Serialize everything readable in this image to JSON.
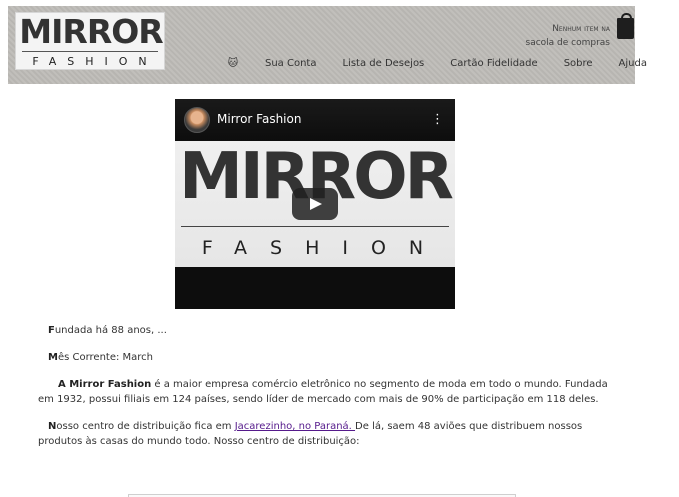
{
  "logo": {
    "top": "MIRROR",
    "bottom": "FASHION"
  },
  "cart": {
    "line1_caps": "Nenhum item na",
    "line2": "sacola de compras",
    "icon": "shopping-bag-icon"
  },
  "nav": {
    "icon": "cat-icon",
    "items": [
      "Sua Conta",
      "Lista de Desejos",
      "Cartão Fidelidade",
      "Sobre",
      "Ajuda"
    ]
  },
  "video": {
    "channel": "Mirror Fashion",
    "frame_top": "MIRROR",
    "frame_bottom": "FASHION",
    "play_icon": "play-icon",
    "menu_icon": "more-vertical-icon"
  },
  "content": {
    "p1": {
      "lead": "F",
      "rest": "undada há 88 anos, ..."
    },
    "p2": {
      "lead": "M",
      "rest": "ês Corrente: March"
    },
    "p3": {
      "brand": "A Mirror Fashion",
      "rest": " é a maior empresa comércio eletrônico no segmento de moda em todo o mundo. Fundada em 1932, possui filiais em 124 países, sendo líder de mercado com mais de 90% de participação em 118 deles."
    },
    "p4": {
      "lead": "N",
      "before": "osso centro de distribuição fica em ",
      "link": "Jacarezinho, no Paraná. ",
      "after": "De lá, saem 48 aviões que distribuem nossos produtos às casas do mundo todo. Nosso centro de distribuição:"
    }
  },
  "colors": {
    "header_bg": "#bdbbb7",
    "link": "#551a8b",
    "video_bg": "#0d0d0d"
  }
}
